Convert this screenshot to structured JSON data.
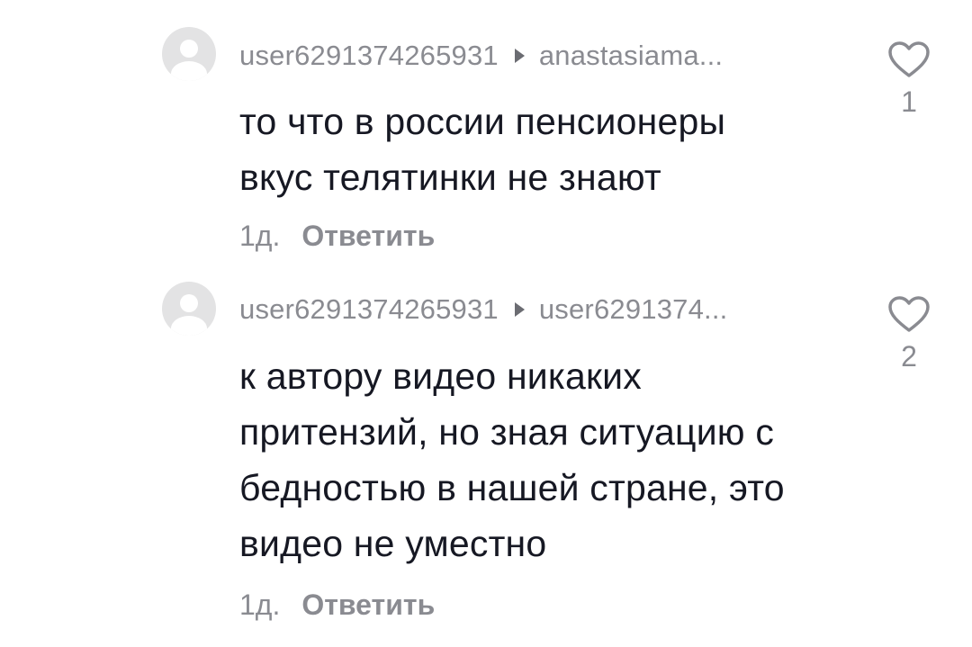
{
  "comments": [
    {
      "author": "user6291374265931",
      "reply_to": "anastasiama...",
      "text_lines": [
        "то что в россии пенсионеры",
        "вкус телятинки не знают"
      ],
      "time": "1д.",
      "reply_label": "Ответить",
      "likes": "1",
      "avatar_icon": "default-avatar-icon",
      "like_icon": "heart-outline-icon"
    },
    {
      "author": "user6291374265931",
      "reply_to": "user6291374...",
      "text_lines": [
        "к автору видео никаких",
        "притензий, но зная ситуацию с",
        "бедностью в нашей стране, это",
        "видео не уместно"
      ],
      "time": "1д.",
      "reply_label": "Ответить",
      "likes": "2",
      "avatar_icon": "default-avatar-icon",
      "like_icon": "heart-outline-icon"
    }
  ],
  "colors": {
    "text_primary": "#161823",
    "text_secondary": "#8a8b91",
    "avatar_bg": "#e3e3e4",
    "avatar_fg": "#ffffff"
  }
}
